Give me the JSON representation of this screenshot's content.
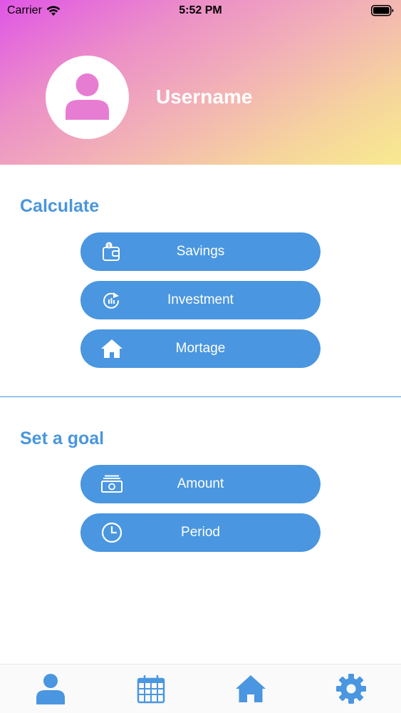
{
  "status_bar": {
    "carrier": "Carrier",
    "time": "5:52 PM"
  },
  "profile": {
    "username": "Username",
    "avatar_icon": "person-icon"
  },
  "calculate": {
    "title": "Calculate",
    "buttons": [
      {
        "label": "Savings",
        "icon": "wallet-icon"
      },
      {
        "label": "Investment",
        "icon": "investment-chart-icon"
      },
      {
        "label": "Mortage",
        "icon": "house-icon"
      }
    ]
  },
  "goal": {
    "title": "Set a goal",
    "buttons": [
      {
        "label": "Amount",
        "icon": "banknote-icon"
      },
      {
        "label": "Period",
        "icon": "clock-icon"
      }
    ]
  },
  "tabbar": {
    "tabs": [
      {
        "icon": "person-icon"
      },
      {
        "icon": "calendar-icon"
      },
      {
        "icon": "house-icon"
      },
      {
        "icon": "gear-icon"
      }
    ]
  },
  "colors": {
    "accent": "#4a96e0",
    "title": "#4a96dc",
    "gradient_start": "#e055e6",
    "gradient_end": "#f8ea90"
  }
}
